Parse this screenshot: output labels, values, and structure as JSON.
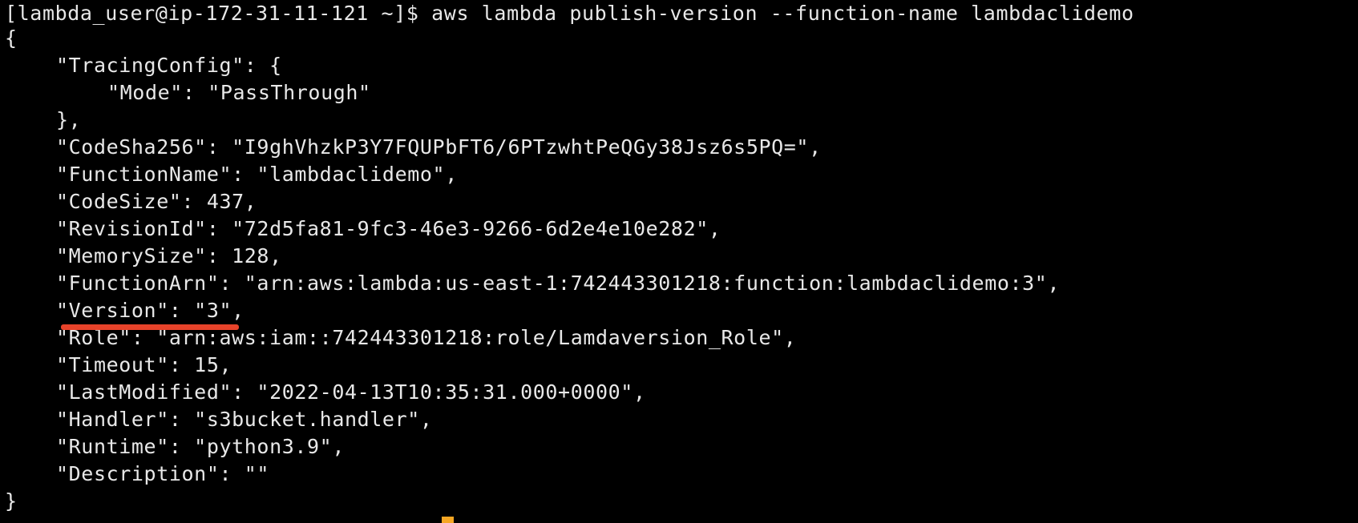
{
  "terminal": {
    "prompt": "[lambda_user@ip-172-31-11-121 ~]$ ",
    "command": "aws lambda publish-version --function-name lambdaclidemo",
    "output": {
      "open_brace": "{",
      "tracing_open": "\"TracingConfig\": {",
      "tracing_mode": "\"Mode\": \"PassThrough\"",
      "tracing_close": "},",
      "code_sha": "\"CodeSha256\": \"I9ghVhzkP3Y7FQUPbFT6/6PTzwhtPeQGy38Jsz6s5PQ=\",",
      "function_name": "\"FunctionName\": \"lambdaclidemo\",",
      "code_size": "\"CodeSize\": 437,",
      "revision_id": "\"RevisionId\": \"72d5fa81-9fc3-46e3-9266-6d2e4e10e282\",",
      "memory_size": "\"MemorySize\": 128,",
      "function_arn": "\"FunctionArn\": \"arn:aws:lambda:us-east-1:742443301218:function:lambdaclidemo:3\",",
      "version": "\"Version\": \"3\",",
      "role": "\"Role\": \"arn:aws:iam::742443301218:role/Lamdaversion_Role\",",
      "timeout": "\"Timeout\": 15,",
      "last_modified": "\"LastModified\": \"2022-04-13T10:35:31.000+0000\",",
      "handler": "\"Handler\": \"s3bucket.handler\",",
      "runtime": "\"Runtime\": \"python3.9\",",
      "description": "\"Description\": \"\"",
      "close_brace": "}"
    }
  },
  "colors": {
    "background": "#000000",
    "text": "#e8e8e8",
    "highlight_underline": "#e8432a",
    "cursor": "#f5a623"
  }
}
